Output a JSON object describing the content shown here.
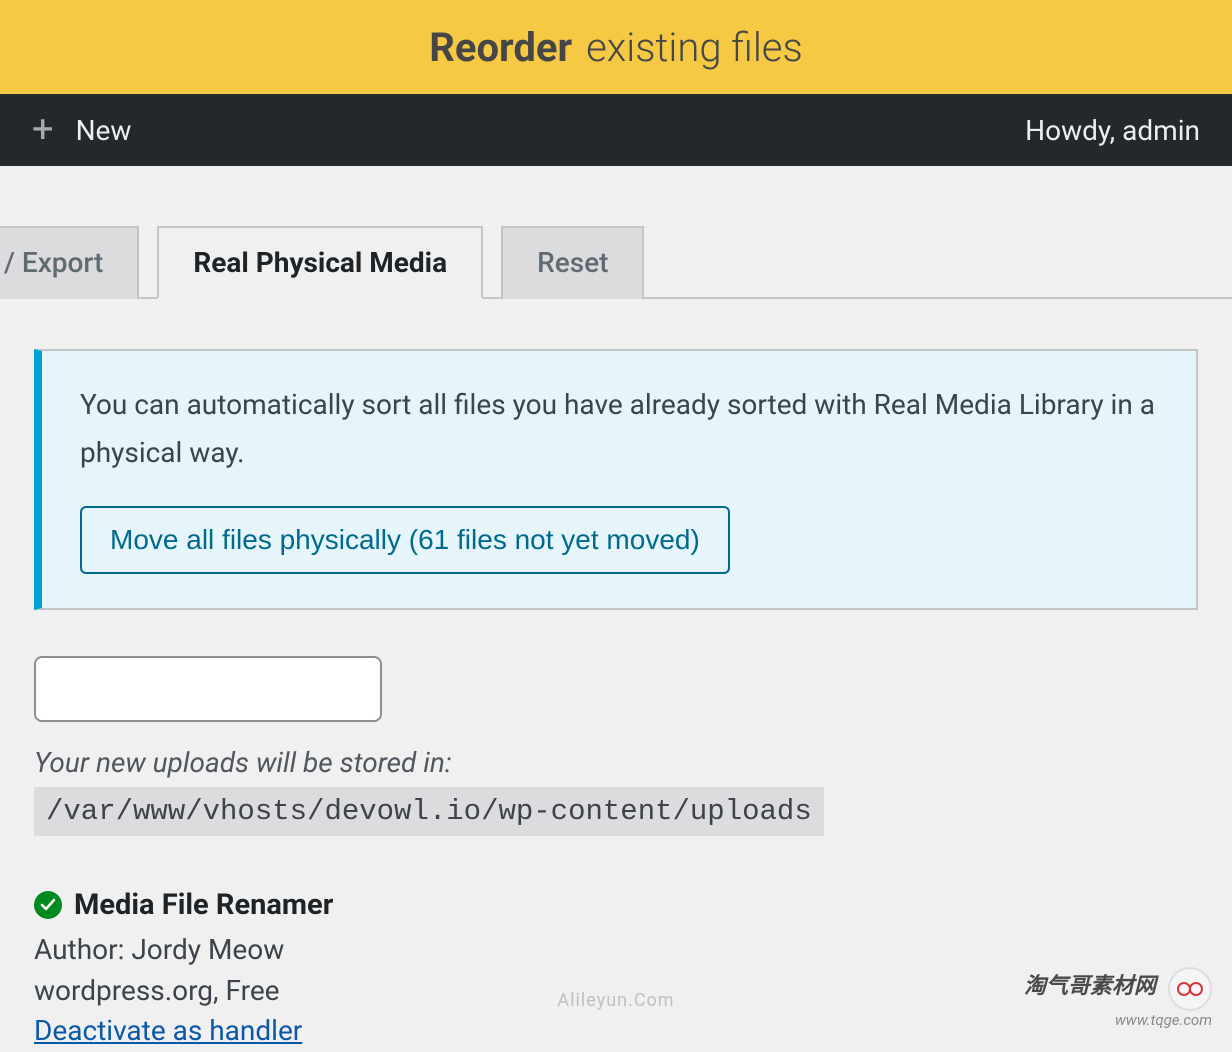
{
  "banner": {
    "bold": "Reorder",
    "rest": "existing files"
  },
  "adminbar": {
    "new_label": "New",
    "howdy": "Howdy, admin"
  },
  "tabs": {
    "export": "/ Export",
    "active": "Real Physical Media",
    "reset": "Reset"
  },
  "notice": {
    "text": "You can automatically sort all files you have already sorted with Real Media Library in a physical way.",
    "button": "Move all files physically (61 files not yet moved)"
  },
  "input": {
    "value": ""
  },
  "upload": {
    "label": "Your new uploads will be stored in:",
    "path": "/var/www/vhosts/devowl.io/wp-content/uploads"
  },
  "plugin": {
    "name": "Media File Renamer",
    "author": "Author: Jordy Meow",
    "source": "wordpress.org, Free",
    "deactivate": "Deactivate as handler"
  },
  "watermarks": {
    "center": "Alileyun.Com",
    "right_cn": "淘气哥素材网",
    "right_url": "www.tqge.com"
  }
}
